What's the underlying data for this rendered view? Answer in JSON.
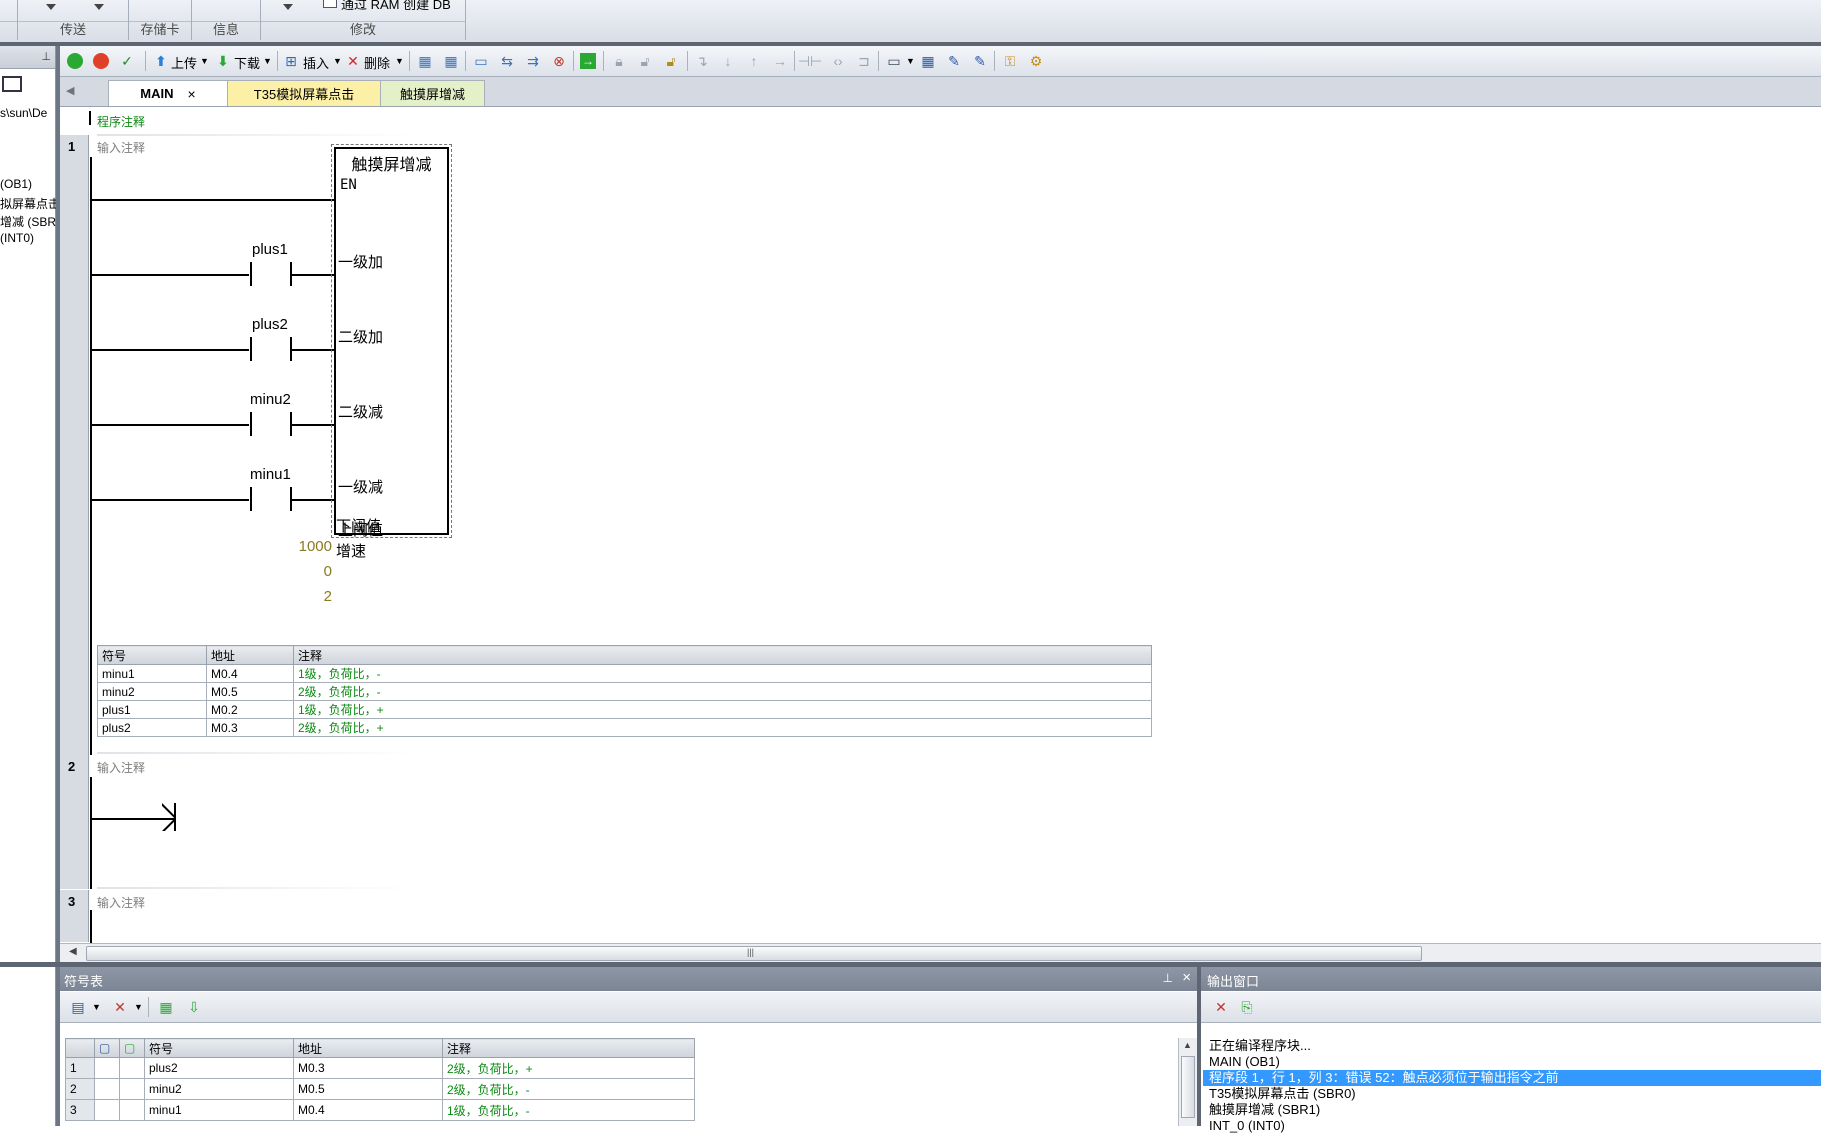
{
  "ribbon": {
    "groups": [
      "传送",
      "存储卡",
      "信息",
      "修改"
    ],
    "partial_item": "通过 RAM 创建 DB"
  },
  "left_panel": {
    "lines": [
      "s\\sun\\De",
      "(OB1)",
      "拟屏幕点击",
      "增减 (SBR",
      " (INT0)"
    ]
  },
  "toolbar": {
    "upload": "上传",
    "download": "下载",
    "insert": "插入",
    "delete": "删除"
  },
  "tabs": [
    {
      "label": "MAIN",
      "closable": true
    },
    {
      "label": "T35模拟屏幕点击"
    },
    {
      "label": "触摸屏增减"
    }
  ],
  "editor": {
    "program_comment": "程序注释",
    "networks": [
      {
        "num": "1",
        "comment": "输入注释"
      },
      {
        "num": "2",
        "comment": "输入注释"
      },
      {
        "num": "3",
        "comment": "输入注释"
      }
    ],
    "block": {
      "title": "触摸屏增减",
      "en": "EN",
      "inputs": [
        "一级加",
        "二级加",
        "二级减",
        "一级减"
      ],
      "params": [
        {
          "value": "1000",
          "label": "上阈值"
        },
        {
          "value": "0",
          "label": "下阈值"
        },
        {
          "value": "2",
          "label": "增速"
        }
      ]
    },
    "contacts": [
      "plus1",
      "plus2",
      "minu2",
      "minu1"
    ],
    "symbol_table": {
      "headers": [
        "符号",
        "地址",
        "注释"
      ],
      "rows": [
        [
          "minu1",
          "M0.4",
          "1级，负荷比，-"
        ],
        [
          "minu2",
          "M0.5",
          "2级，负荷比，-"
        ],
        [
          "plus1",
          "M0.2",
          "1级，负荷比，+"
        ],
        [
          "plus2",
          "M0.3",
          "2级，负荷比，+"
        ]
      ]
    }
  },
  "symbol_panel": {
    "title": "符号表",
    "headers": [
      "符号",
      "地址",
      "注释"
    ],
    "rows": [
      [
        "1",
        "plus2",
        "M0.3",
        "2级，负荷比，+"
      ],
      [
        "2",
        "minu2",
        "M0.5",
        "2级，负荷比，-"
      ],
      [
        "3",
        "minu1",
        "M0.4",
        "1级，负荷比，-"
      ]
    ]
  },
  "output_panel": {
    "title": "输出窗口",
    "lines": [
      "正在编译程序块...",
      "MAIN (OB1)",
      "程序段 1，行 1，列 3：错误 52：触点必须位于输出指令之前",
      "T35模拟屏幕点击 (SBR0)",
      "触摸屏增减 (SBR1)",
      "INT_0 (INT0)"
    ]
  },
  "colors": {
    "accent_selection": "#3399ff",
    "comment_green": "#0d8a14",
    "param_olive": "#8a7a22",
    "tab_yellow": "#fbf0a6"
  }
}
